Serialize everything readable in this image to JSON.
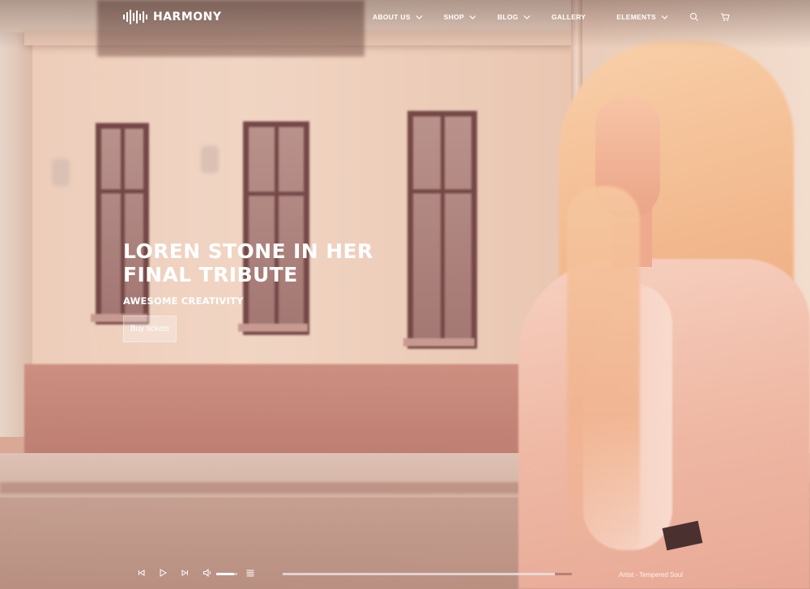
{
  "brand": {
    "name": "HARMONY"
  },
  "nav": {
    "items": [
      {
        "label": "ABOUT US",
        "has_dropdown": true
      },
      {
        "label": "SHOP",
        "has_dropdown": true
      },
      {
        "label": "BLOG",
        "has_dropdown": true
      },
      {
        "label": "GALLERY",
        "has_dropdown": false
      },
      {
        "label": "ELEMENTS",
        "has_dropdown": true
      }
    ],
    "icons": [
      "search-icon",
      "cart-icon"
    ]
  },
  "hero": {
    "title_line1": "LOREN STONE IN HER",
    "title_line2": "FINAL TRIBUTE",
    "subtitle": "AWESOME CREATIVITY",
    "button_label": "Buy tickets"
  },
  "player": {
    "controls": [
      "previous-icon",
      "play-icon",
      "next-icon",
      "volume-icon",
      "playlist-icon"
    ],
    "volume_fraction": 0.85,
    "progress_fraction": 0.94,
    "track_info": "Artist - Tempered Soul"
  },
  "colors": {
    "text": "#ffffff",
    "button_bg": "rgba(255,255,255,0.28)"
  }
}
